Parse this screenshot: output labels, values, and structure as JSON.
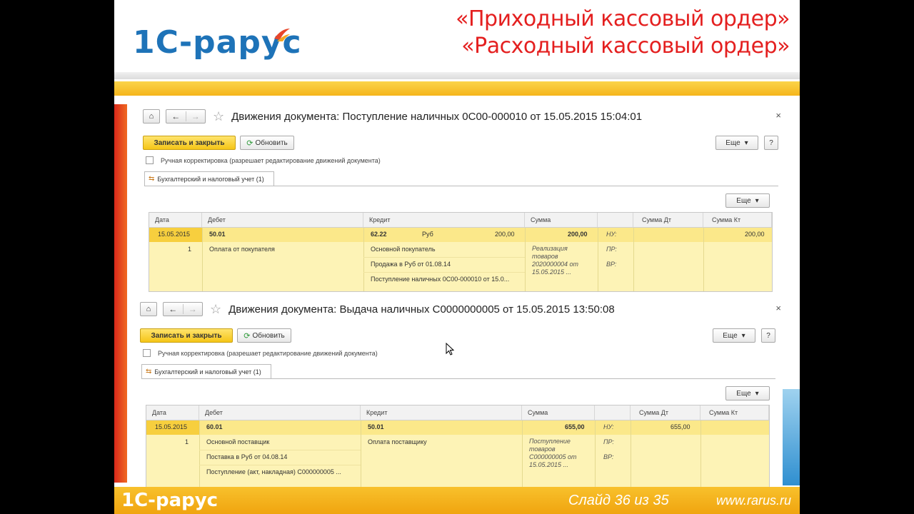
{
  "slide": {
    "logo_text": "1С-рарус",
    "title_line1": "«Приходный кассовый ордер»",
    "title_line2": "«Расходный кассовый ордер»",
    "footer_logo": "1С-рарус",
    "footer_slide": "Слайд 36 из 35",
    "footer_url": "www.rarus.ru"
  },
  "colors": {
    "accent_red": "#e41f1f",
    "accent_yellow": "#f5c517",
    "brand_blue": "#1e73b8"
  },
  "window1": {
    "title": "Движения документа: Поступление наличных 0С00-000010 от 15.05.2015 15:04:01",
    "save_close": "Записать и закрыть",
    "refresh": "Обновить",
    "more": "Еще",
    "help": "?",
    "manual_label": "Ручная корректировка (разрешает редактирование движений документа)",
    "tab_label": "Бухгалтерский и налоговый учет (1)",
    "columns": [
      "Дата",
      "Дебет",
      "Кредит",
      "Сумма",
      "Сумма Дт",
      "Сумма Кт"
    ],
    "row": {
      "date": "15.05.2015",
      "num": "1",
      "debit_acc": "50.01",
      "debit_sub1": "Оплата от покупателя",
      "credit_acc": "62.22",
      "credit_cur": "Руб",
      "credit_cur_sum": "200,00",
      "credit_sub1": "Основной покупатель",
      "credit_sub2": "Продажа в Руб от 01.08.14",
      "credit_sub3": "Поступление наличных 0С00-000010 от 15.0...",
      "sum": "200,00",
      "content": "Реализация товаров 2020000004 от 15.05.2015 ...",
      "nu": "НУ:",
      "pr": "ПР:",
      "vr": "ВР:",
      "sum_dt": "",
      "sum_kt": "200,00"
    }
  },
  "window2": {
    "title": "Движения документа: Выдача наличных С0000000005 от 15.05.2015 13:50:08",
    "save_close": "Записать и закрыть",
    "refresh": "Обновить",
    "more": "Еще",
    "help": "?",
    "manual_label": "Ручная корректировка (разрешает редактирование движений документа)",
    "tab_label": "Бухгалтерский и налоговый учет (1)",
    "columns": [
      "Дата",
      "Дебет",
      "Кредит",
      "Сумма",
      "Сумма Дт",
      "Сумма Кт"
    ],
    "row": {
      "date": "15.05.2015",
      "num": "1",
      "debit_acc": "60.01",
      "debit_sub1": "Основной поставщик",
      "debit_sub2": "Поставка в Руб от 04.08.14",
      "debit_sub3": "Поступление (акт, накладная) С000000005 ...",
      "credit_acc": "50.01",
      "credit_sub1": "Оплата поставщику",
      "sum": "655,00",
      "content": "Поступление товаров С000000005 от 15.05.2015 ...",
      "nu": "НУ:",
      "pr": "ПР:",
      "vr": "ВР:",
      "sum_dt": "655,00",
      "sum_kt": ""
    }
  }
}
